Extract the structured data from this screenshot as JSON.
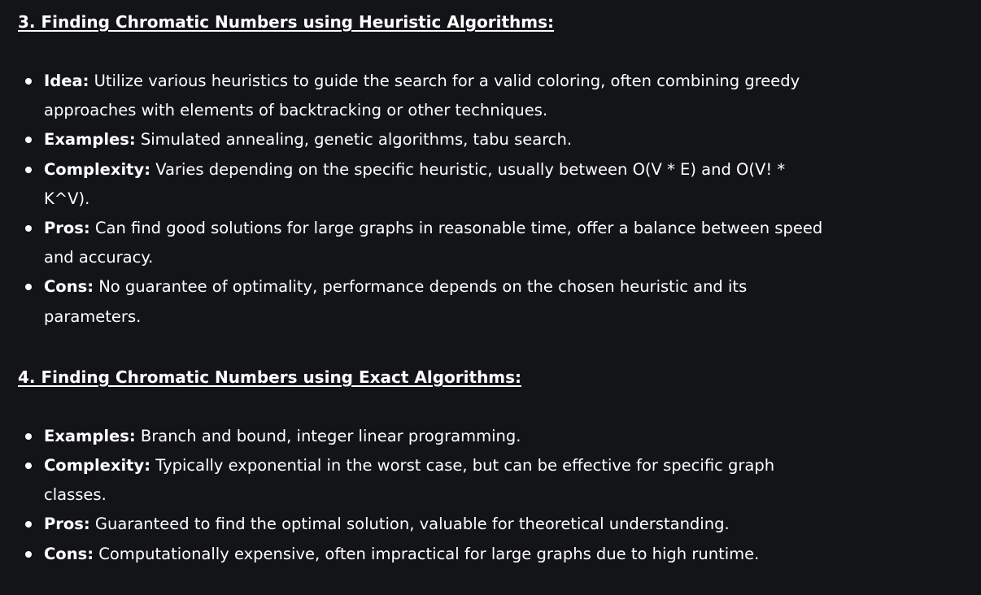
{
  "section_3": {
    "heading": "3. Finding Chromatic Numbers using Heuristic Algorithms:",
    "items": [
      {
        "label": "Idea:",
        "text": " Utilize various heuristics to guide the search for a valid coloring, often combining greedy approaches with elements of backtracking or other techniques."
      },
      {
        "label": "Examples:",
        "text": " Simulated annealing, genetic algorithms, tabu search."
      },
      {
        "label": "Complexity:",
        "text": " Varies depending on the specific heuristic, usually between O(V * E) and O(V! * K^V)."
      },
      {
        "label": "Pros:",
        "text": " Can find good solutions for large graphs in reasonable time, offer a balance between speed and accuracy."
      },
      {
        "label": "Cons:",
        "text": " No guarantee of optimality, performance depends on the chosen heuristic and its parameters."
      }
    ]
  },
  "section_4": {
    "heading": "4. Finding Chromatic Numbers using Exact Algorithms:",
    "items": [
      {
        "label": "Examples:",
        "text": " Branch and bound, integer linear programming."
      },
      {
        "label": "Complexity:",
        "text": " Typically exponential in the worst case, but can be effective for specific graph classes."
      },
      {
        "label": "Pros:",
        "text": " Guaranteed to find the optimal solution, valuable for theoretical understanding."
      },
      {
        "label": "Cons:",
        "text": " Computationally expensive, often impractical for large graphs due to high runtime."
      }
    ]
  }
}
